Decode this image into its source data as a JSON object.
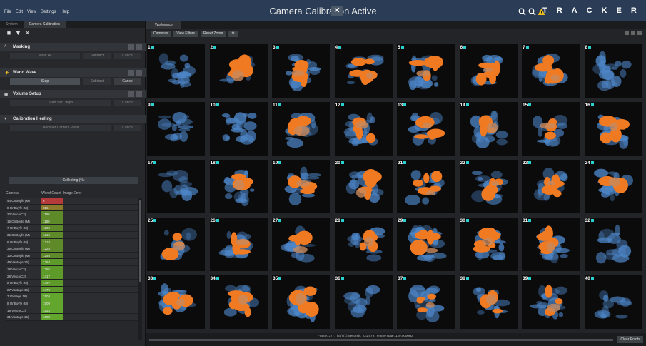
{
  "titlebar": {
    "menu": [
      "File",
      "Edit",
      "View",
      "Settings",
      "Help"
    ],
    "title": "Camera Calibration Active",
    "brand": "TRACKER"
  },
  "left_panel": {
    "tabs": [
      "System",
      "Camera Calibration"
    ],
    "sections": {
      "masking": {
        "title": "Masking",
        "fields": [
          "Mask All",
          "Subtract",
          "Cancel"
        ]
      },
      "wand_wave": {
        "title": "Wand Wave",
        "fields": [
          "Stop",
          "Subtract",
          "Cancel"
        ]
      },
      "volume_setup": {
        "title": "Volume Setup",
        "fields": [
          "Start Set Origin",
          "Cancel"
        ]
      },
      "calibration_healing": {
        "title": "Calibration Healing",
        "fields": [
          "Recover Camera Pose",
          "Cancel"
        ]
      }
    },
    "collecting": "Collecting (%)",
    "columns": [
      "Camera",
      "Wand Count",
      "Image Error"
    ],
    "cameras": [
      {
        "name": "44 OnBoyfe (M)",
        "count": "6",
        "color": "#b53a3a"
      },
      {
        "name": "8 OnBoyfe (M)",
        "count": "816",
        "color": "#8a7a2a"
      },
      {
        "name": "20 Vero vC2)",
        "count": "1186",
        "color": "#5e8a2a"
      },
      {
        "name": "16 OnBoyfe (M)",
        "count": "1189",
        "color": "#5e8a2a"
      },
      {
        "name": "7 OnBoyfe (M)",
        "count": "1202",
        "color": "#5e8a2a"
      },
      {
        "name": "35 OnBoyfe (M)",
        "count": "1210",
        "color": "#5e8a2a"
      },
      {
        "name": "6 OnBoyfe (M)",
        "count": "1218",
        "color": "#5e8a2a"
      },
      {
        "name": "36 OnBoyfe (M)",
        "count": "1225",
        "color": "#5e8a2a"
      },
      {
        "name": "13 OnBoyfe (M)",
        "count": "1246",
        "color": "#5e8a2a"
      },
      {
        "name": "49 Vantage 16)",
        "count": "1263",
        "color": "#5e9a2a"
      },
      {
        "name": "18 Vero vC2)",
        "count": "1365",
        "color": "#5e9a2a"
      },
      {
        "name": "28 Vero vC2)",
        "count": "1417",
        "color": "#5e9a2a"
      },
      {
        "name": "2 OnBoyfe (M)",
        "count": "1467",
        "color": "#5e9a2a"
      },
      {
        "name": "27 Vantage 16)",
        "count": "1479",
        "color": "#5e9a2a"
      },
      {
        "name": "7 Vantage 16)",
        "count": "1504",
        "color": "#62a62e"
      },
      {
        "name": "8 OnBoyfe (M)",
        "count": "1509",
        "color": "#62a62e"
      },
      {
        "name": "19 Vero vC2)",
        "count": "1523",
        "color": "#62a62e"
      },
      {
        "name": "31 Vantage 16)",
        "count": "1588",
        "color": "#62a62e"
      }
    ]
  },
  "workspace": {
    "tab": "Workspace",
    "toolbar": [
      "Cameras",
      "View Filters",
      "Reset Zoom",
      "⚙"
    ],
    "tiles": [
      "1",
      "2",
      "3",
      "4",
      "5",
      "6",
      "7",
      "8",
      "9",
      "10",
      "11",
      "12",
      "13",
      "14",
      "15",
      "16",
      "17",
      "18",
      "19",
      "20",
      "21",
      "22",
      "23",
      "24",
      "25",
      "26",
      "27",
      "28",
      "29",
      "30",
      "31",
      "32",
      "33",
      "34",
      "35",
      "36",
      "37",
      "38",
      "39",
      "40"
    ],
    "status": "Frame: 3777 (40) (1)    Seconds: 221.9797    Frame Rate: 120.0000Hz",
    "clear_button": "Clear Points",
    "colors": {
      "orange": "#f07a22",
      "blue": "#4d86c8",
      "tan": "#c88a5e",
      "accent": "#2ad1d1"
    }
  }
}
